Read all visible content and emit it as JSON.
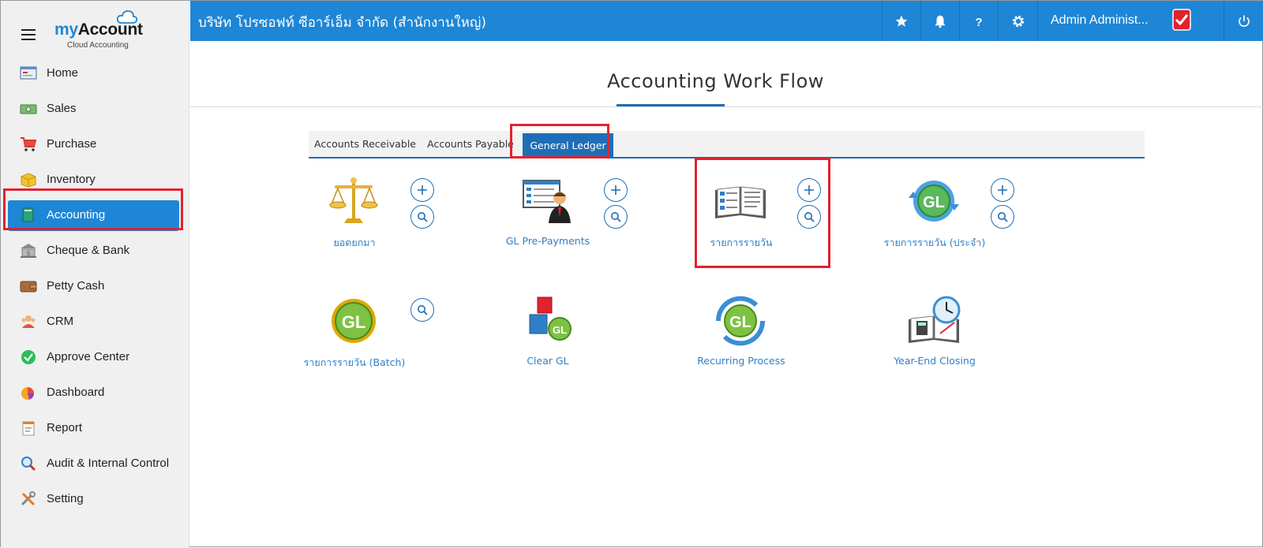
{
  "app": {
    "logo_prefix": "my",
    "logo_main": "Account",
    "logo_sub": "Cloud Accounting",
    "accent_color": "#1e86d6"
  },
  "header": {
    "company": "บริษัท โปรซอฟท์ ซีอาร์เอ็ม จำกัด (สำนักงานใหญ่)",
    "user_name": "Admin Administ...",
    "icons": [
      "star-icon",
      "bell-icon",
      "help-icon",
      "gear-icon",
      "power-icon"
    ]
  },
  "sidebar": {
    "items": [
      {
        "label": "Home",
        "icon": "home-icon"
      },
      {
        "label": "Sales",
        "icon": "money-icon"
      },
      {
        "label": "Purchase",
        "icon": "cart-icon"
      },
      {
        "label": "Inventory",
        "icon": "box-icon"
      },
      {
        "label": "Accounting",
        "icon": "book-icon",
        "active": true
      },
      {
        "label": "Cheque & Bank",
        "icon": "bank-icon"
      },
      {
        "label": "Petty Cash",
        "icon": "wallet-icon"
      },
      {
        "label": "CRM",
        "icon": "people-icon"
      },
      {
        "label": "Approve Center",
        "icon": "check-icon"
      },
      {
        "label": "Dashboard",
        "icon": "pie-chart-icon"
      },
      {
        "label": "Report",
        "icon": "report-icon"
      },
      {
        "label": "Audit & Internal Control",
        "icon": "magnifier-icon"
      },
      {
        "label": "Setting",
        "icon": "tools-icon"
      }
    ]
  },
  "main": {
    "title": "Accounting Work Flow",
    "tabs": [
      {
        "label": "Accounts Receivable"
      },
      {
        "label": "Accounts Payable"
      },
      {
        "label": "General Ledger",
        "active": true
      }
    ],
    "tiles": [
      {
        "label": "ยอดยกมา",
        "icon": "scales-icon",
        "add": true,
        "search": true
      },
      {
        "label": "GL Pre-Payments",
        "icon": "ledger-person-icon",
        "add": true,
        "search": true
      },
      {
        "label": "รายการรายวัน",
        "icon": "open-book-icon",
        "add": true,
        "search": true
      },
      {
        "label": "รายการรายวัน (ประจำ)",
        "icon": "gl-cycle-icon",
        "add": true,
        "search": true
      },
      {
        "label": "รายการรายวัน (Batch)",
        "icon": "gl-badge-icon",
        "add": false,
        "search": true
      },
      {
        "label": "Clear GL",
        "icon": "gl-blocks-icon",
        "add": false,
        "search": false
      },
      {
        "label": "Recurring Process",
        "icon": "gl-recycle-icon",
        "add": false,
        "search": false
      },
      {
        "label": "Year-End Closing",
        "icon": "calendar-clock-icon",
        "add": false,
        "search": false
      }
    ]
  }
}
